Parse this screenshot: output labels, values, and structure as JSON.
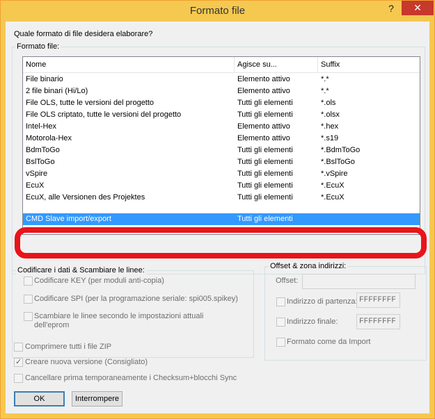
{
  "window": {
    "title": "Formato file",
    "help_glyph": "?",
    "close_glyph": "✕"
  },
  "prompt": "Quale formato di file desidera elaborare?",
  "format_group": {
    "label": "Formato file:",
    "columns": [
      "Nome",
      "Agisce su...",
      "Suffix"
    ],
    "rows": [
      {
        "name": "File binario",
        "scope": "Elemento attivo",
        "suffix": "*.*"
      },
      {
        "name": "2 file binari (Hi/Lo)",
        "scope": "Elemento attivo",
        "suffix": "*.*"
      },
      {
        "name": "File OLS, tutte le versioni del progetto",
        "scope": "Tutti gli elementi",
        "suffix": "*.ols"
      },
      {
        "name": " File OLS criptato, tutte le versioni del progetto",
        "scope": "Tutti gli elementi",
        "suffix": "*.olsx"
      },
      {
        "name": "Intel-Hex",
        "scope": "Elemento attivo",
        "suffix": "*.hex"
      },
      {
        "name": "Motorola-Hex",
        "scope": "Elemento attivo",
        "suffix": "*.s19"
      },
      {
        "name": "BdmToGo",
        "scope": "Tutti gli elementi",
        "suffix": "*.BdmToGo"
      },
      {
        "name": "BslToGo",
        "scope": "Tutti gli elementi",
        "suffix": "*.BslToGo"
      },
      {
        "name": "vSpire",
        "scope": "Tutti gli elementi",
        "suffix": "*.vSpire"
      },
      {
        "name": "EcuX",
        "scope": "Tutti gli elementi",
        "suffix": "*.EcuX"
      },
      {
        "name": "EcuX, alle Versionen des Projektes",
        "scope": "Tutti gli elementi",
        "suffix": "*.EcuX"
      },
      {
        "name": "CMD Slave import/export",
        "scope": "Tutti gli elementi",
        "suffix": ""
      }
    ],
    "selected_index": 11
  },
  "encode_group": {
    "label": "Codificare i dati & Scambiare le linee:",
    "key_label": "Codificare KEY  (per moduli anti-copia)",
    "spi_label": "Codificare SPI (per la programazione seriale: spi005.spikey)",
    "swap_label_1": "Scambiare le linee secondo le impostazioni attuali",
    "swap_label_2": "dell'eprom"
  },
  "offset_group": {
    "label": "Offset & zona indirizzi:",
    "offset_label": "Offset:",
    "offset_value": "",
    "start_label": "Indirizzo di partenza:",
    "start_value": "FFFFFFFF",
    "end_label": "Indirizzo finale:",
    "end_value": "FFFFFFFF",
    "import_label": "Formato come da Import"
  },
  "options": {
    "zip_label": "Comprimere tutti i file ZIP",
    "new_version_label": "Creare nuova versione (Consigliato)",
    "new_version_checked": true,
    "check_mark": "✓",
    "checksum_label": "Cancellare prima temporaneamente i Checksum+blocchi Sync"
  },
  "buttons": {
    "ok": "OK",
    "cancel": "Interrompere"
  },
  "colors": {
    "title_bar": "#f5c850",
    "close_button": "#c7392b",
    "selection": "#3399ff",
    "highlight_outline": "#e8141a"
  }
}
